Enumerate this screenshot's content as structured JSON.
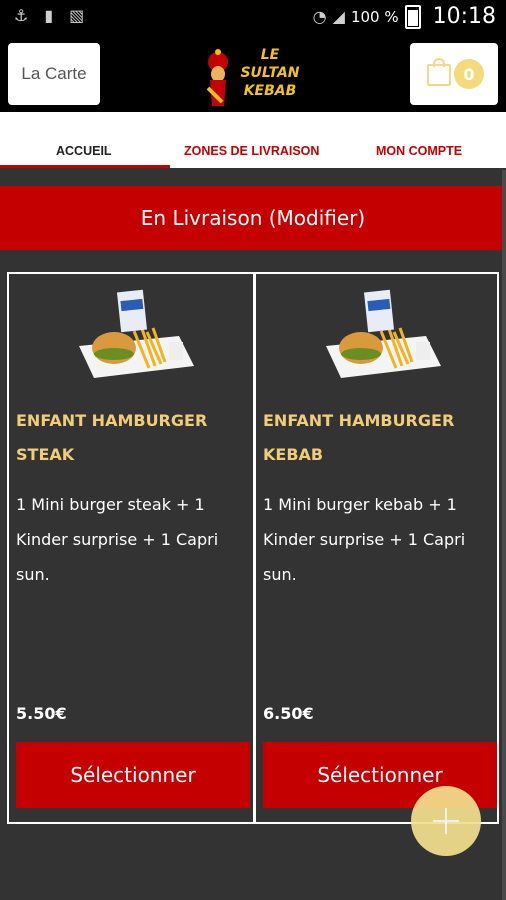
{
  "status_bar": {
    "battery_percent": "100 %",
    "time": "10:18",
    "icons": [
      "usb-icon",
      "battery-100-icon",
      "sim-icon",
      "wifi-icon",
      "signal-icon"
    ]
  },
  "header": {
    "menu_button_label": "La Carte",
    "logo_line1": "LE SULTAN",
    "logo_line2": "KEBAB",
    "cart_count": "0"
  },
  "tabs": [
    {
      "label": "ACCUEIL",
      "active": true
    },
    {
      "label": "ZONES DE LIVRAISON",
      "active": false
    },
    {
      "label": "MON COMPTE",
      "active": false
    }
  ],
  "delivery_banner": "En Livraison (Modifier)",
  "products": [
    {
      "title": "ENFANT HAMBURGER STEAK",
      "description": "1 Mini burger steak  + 1 Kinder surprise  + 1 Capri sun.",
      "price": "5.50€",
      "button_label": "Sélectionner"
    },
    {
      "title": "ENFANT HAMBURGER KEBAB",
      "description": "1 Mini burger kebab  + 1 Kinder surprise  + 1 Capri sun.",
      "price": "6.50€",
      "button_label": "Sélectionner"
    }
  ],
  "colors": {
    "brand_red": "#c40000",
    "gold": "#f1cd7a",
    "background": "#333333"
  }
}
